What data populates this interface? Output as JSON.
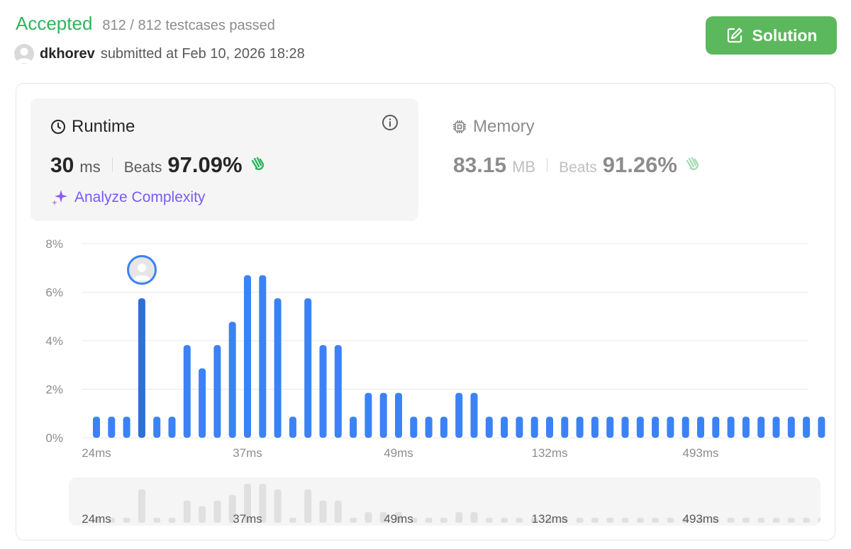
{
  "status": {
    "verdict": "Accepted",
    "testcases": "812 / 812 testcases passed"
  },
  "submission": {
    "user": "dkhorev",
    "submitted_text": "submitted at Feb 10, 2026 18:28"
  },
  "solution_button": {
    "label": "Solution",
    "icon": "edit-icon"
  },
  "runtime": {
    "title": "Runtime",
    "icon": "clock-icon",
    "value": "30",
    "unit": "ms",
    "beats_label": "Beats",
    "beats_value": "97.09%",
    "analyze_label": "Analyze Complexity"
  },
  "memory": {
    "title": "Memory",
    "icon": "chip-icon",
    "value": "83.15",
    "unit": "MB",
    "beats_label": "Beats",
    "beats_value": "91.26%"
  },
  "colors": {
    "accent_green": "#2db55d",
    "bar_blue": "#3b82f6",
    "bar_selected": "#2f6fd6",
    "analyze_purple": "#7a5af8"
  },
  "chart_data": {
    "type": "bar",
    "yticks": [
      "0%",
      "2%",
      "4%",
      "6%",
      "8%"
    ],
    "ylim": [
      0,
      8
    ],
    "xticks": [
      {
        "index": 0,
        "label": "24ms"
      },
      {
        "index": 10,
        "label": "37ms"
      },
      {
        "index": 20,
        "label": "49ms"
      },
      {
        "index": 30,
        "label": "132ms"
      },
      {
        "index": 40,
        "label": "493ms"
      }
    ],
    "selected_index": 3,
    "values": [
      0.87,
      0.87,
      0.87,
      5.75,
      0.87,
      0.87,
      3.82,
      2.86,
      3.82,
      4.78,
      6.7,
      6.7,
      5.75,
      0.87,
      5.75,
      3.82,
      3.82,
      0.87,
      1.85,
      1.85,
      1.85,
      0.87,
      0.87,
      0.87,
      1.85,
      1.85,
      0.87,
      0.87,
      0.87,
      0.87,
      0.87,
      0.87,
      0.87,
      0.87,
      0.87,
      0.87,
      0.87,
      0.87,
      0.87,
      0.87,
      0.87,
      0.87,
      0.87,
      0.87,
      0.87,
      0.87,
      0.87,
      0.87,
      0.87
    ]
  }
}
